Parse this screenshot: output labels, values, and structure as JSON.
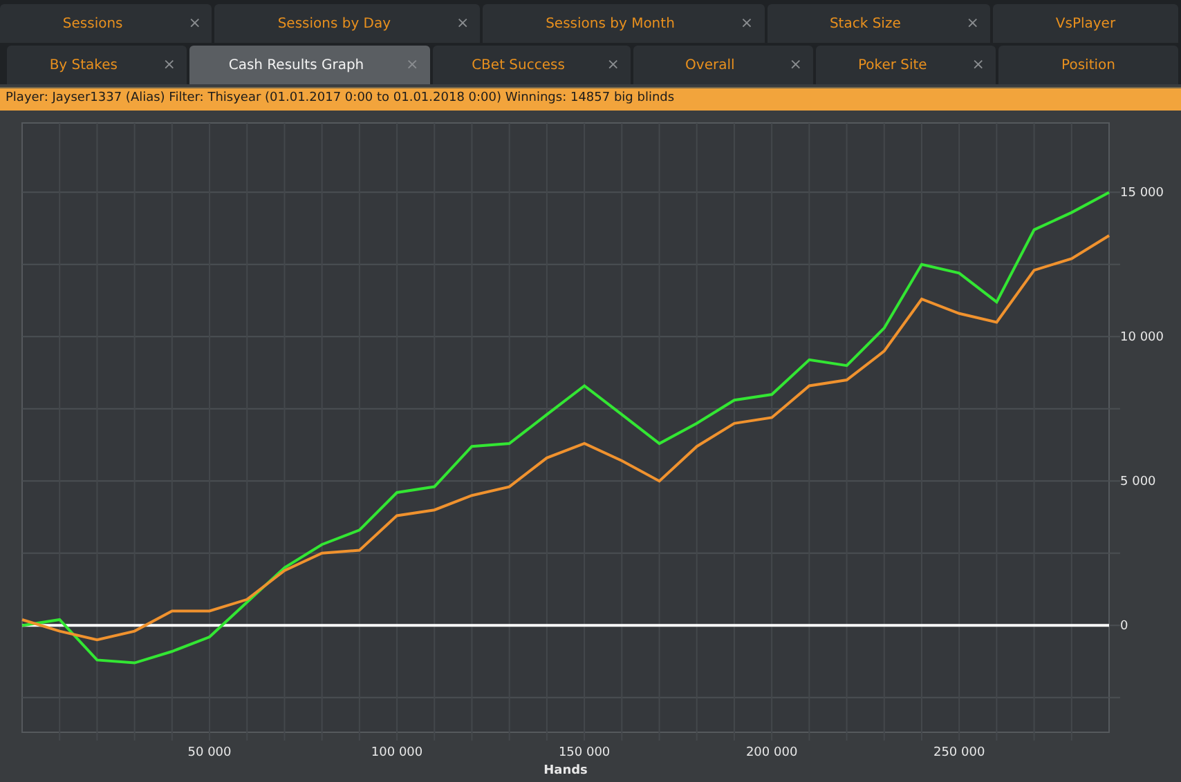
{
  "tab_rows": [
    {
      "tabs": [
        {
          "label": "Sessions",
          "close": "×",
          "selected": false
        },
        {
          "label": "Sessions by Day",
          "close": "×",
          "selected": false
        },
        {
          "label": "Sessions by Month",
          "close": "×",
          "selected": false
        },
        {
          "label": "Stack Size",
          "close": "×",
          "selected": false
        },
        {
          "label": "VsPlayer",
          "selected": false
        }
      ]
    },
    {
      "tabs": [
        {
          "label": "By Stakes",
          "close": "×",
          "selected": false
        },
        {
          "label": "Cash Results Graph",
          "close": "×",
          "selected": true
        },
        {
          "label": "CBet Success",
          "close": "×",
          "selected": false
        },
        {
          "label": "Overall",
          "close": "×",
          "selected": false
        },
        {
          "label": "Poker Site",
          "close": "×",
          "selected": false
        },
        {
          "label": "Position",
          "selected": false
        }
      ]
    }
  ],
  "filter_bar": {
    "text": "Player: Jayser1337 (Alias) Filter: Thisyear (01.01.2017 0:00 to 01.01.2018 0:00) Winnings: 14857 big blinds"
  },
  "graph": {
    "chart_data": {
      "type": "line",
      "xlabel": "Hands",
      "x": [
        0,
        10000,
        20000,
        30000,
        40000,
        50000,
        60000,
        70000,
        80000,
        90000,
        100000,
        110000,
        120000,
        130000,
        140000,
        150000,
        160000,
        170000,
        180000,
        190000,
        200000,
        210000,
        220000,
        230000,
        240000,
        250000,
        260000,
        270000,
        280000,
        290000
      ],
      "series": [
        {
          "color": "#33e633",
          "values": [
            0,
            200,
            -1200,
            -1300,
            -900,
            -400,
            800,
            2000,
            2800,
            3300,
            4600,
            4800,
            6200,
            6300,
            7300,
            8300,
            7300,
            6300,
            7000,
            7800,
            8000,
            9200,
            9000,
            10300,
            12500,
            12200,
            11200,
            13700,
            14300,
            15000
          ]
        },
        {
          "color": "#f0922e",
          "values": [
            200,
            -200,
            -500,
            -200,
            500,
            500,
            900,
            1900,
            2500,
            2600,
            3800,
            4000,
            4500,
            4800,
            5800,
            6300,
            5700,
            5000,
            6200,
            7000,
            7200,
            8300,
            8500,
            9500,
            11300,
            10800,
            10500,
            12300,
            12700,
            13500
          ]
        }
      ],
      "grid": true,
      "xlim": [
        0,
        290000
      ],
      "ylim": [
        -3700,
        17400
      ],
      "xticks": [
        {
          "value": 50000,
          "label": "50 000"
        },
        {
          "value": 100000,
          "label": "100 000"
        },
        {
          "value": 150000,
          "label": "150 000"
        },
        {
          "value": 200000,
          "label": "200 000"
        },
        {
          "value": 250000,
          "label": "250 000"
        }
      ],
      "yticks": [
        {
          "value": 0,
          "label": "0"
        },
        {
          "value": 5000,
          "label": "5 000"
        },
        {
          "value": 10000,
          "label": "10 000"
        },
        {
          "value": 15000,
          "label": "15 000"
        }
      ]
    }
  }
}
